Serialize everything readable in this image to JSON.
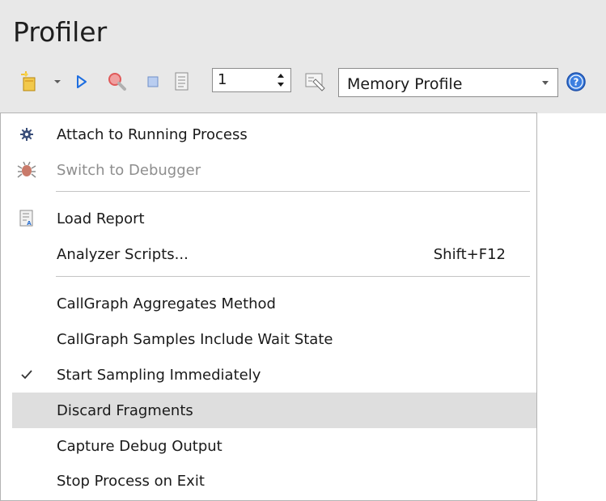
{
  "panel": {
    "title": "Profiler"
  },
  "toolbar": {
    "new_icon": "new-profile-icon",
    "dropdown_icon": "chevron-down-icon",
    "run_icon": "play-icon",
    "search_icon": "magnifier-icon",
    "stop_icon": "stop-icon",
    "report_icon": "report-icon",
    "tag_icon": "tag-icon",
    "help_icon": "help-icon",
    "spin_value": "1",
    "profile_value": "Memory Profile"
  },
  "menu": {
    "items": [
      {
        "label": "Attach to Running Process",
        "icon": "gear-icon",
        "disabled": false
      },
      {
        "label": "Switch to Debugger",
        "icon": "bug-icon",
        "disabled": true
      },
      {
        "label": "Load Report",
        "icon": "report-icon",
        "disabled": false
      },
      {
        "label": "Analyzer Scripts...",
        "shortcut": "Shift+F12",
        "disabled": false
      },
      {
        "label": "CallGraph Aggregates Method",
        "disabled": false
      },
      {
        "label": "CallGraph Samples Include Wait State",
        "disabled": false
      },
      {
        "label": "Start Sampling Immediately",
        "icon": "checkmark-icon",
        "checked": true,
        "disabled": false
      },
      {
        "label": "Discard Fragments",
        "highlighted": true,
        "disabled": false
      },
      {
        "label": "Capture Debug Output",
        "disabled": false
      },
      {
        "label": "Stop Process on Exit",
        "disabled": false
      }
    ]
  },
  "colors": {
    "panel_bg": "#e8e8e8",
    "highlight_bg": "#dedede",
    "accent_blue": "#1e6ee0",
    "disabled_text": "#8e8e8e"
  }
}
